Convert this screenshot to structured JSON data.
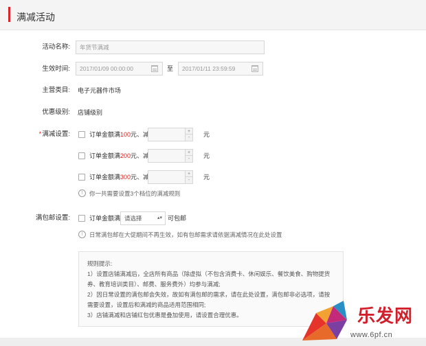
{
  "header": {
    "title": "满减活动"
  },
  "form": {
    "activity_name": {
      "label": "活动名称:",
      "value": "年货节满减"
    },
    "time": {
      "label": "生效时间:",
      "start": "2017/01/09 00:00:00",
      "sep": "至",
      "end": "2017/01/11 23:59:59"
    },
    "category": {
      "label": "主营类目:",
      "value": "电子元器件市场"
    },
    "level": {
      "label": "优惠级别:",
      "value": "店铺级别"
    },
    "discount": {
      "required_mark": "*",
      "label": "满减设置:",
      "rows": [
        {
          "prefix": "订单金额满",
          "amount": "100",
          "suffix": "元、减",
          "unit": "元"
        },
        {
          "prefix": "订单金额满",
          "amount": "200",
          "suffix": "元、减",
          "unit": "元"
        },
        {
          "prefix": "订单金额满",
          "amount": "300",
          "suffix": "元、减",
          "unit": "元"
        }
      ],
      "hint": "你一共需要设置3个档位的满减规则"
    },
    "free_shipping": {
      "label": "满包邮设置:",
      "prefix": "订单金额满",
      "select_value": "请选择",
      "suffix": "可包邮",
      "hint": "日常满包邮在大促期间不再生效，如有包邮需求请依据满减情况在此处设置"
    }
  },
  "rules": {
    "title": "规则提示:",
    "lines": [
      "1）设置店铺满减后，全店所有商品（除虚拟（不包含消费卡、休闲娱乐、餐饮美食、购物提货",
      "券、教育培训类目）、邮费、服务费外）均参与满减;",
      "2）因日常设置的满包邮会失效，故如有满包邮的需求，请在此处设置，满包邮非必选项，请按",
      "需要设置，设置后和满减的商品适用范围相同;",
      "3）店铺满减和店铺红包优惠是叠加使用，请设置合理优惠。"
    ]
  },
  "watermark": {
    "brand": "乐发网",
    "url": "www.6pf.cn"
  },
  "icons": {
    "calendar": "calendar-icon",
    "info": "info-icon",
    "stepper_up": "+",
    "stepper_down": "-",
    "info_glyph": "!",
    "caret": "▴▾"
  },
  "colors": {
    "accent": "#d9232d",
    "required": "#e02020"
  }
}
